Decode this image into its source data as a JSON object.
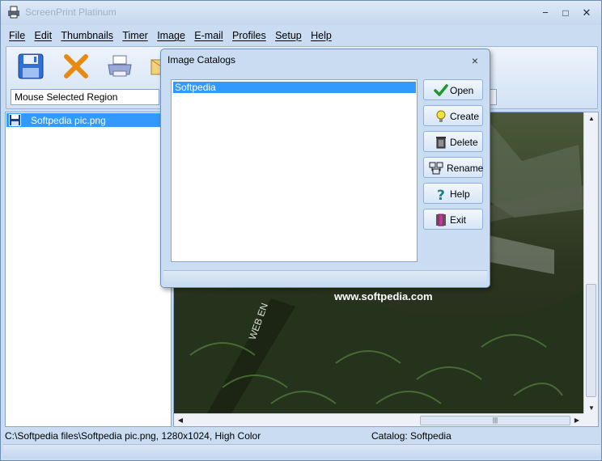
{
  "app": {
    "title": "ScreenPrint Platinum"
  },
  "window_controls": {
    "minimize": "−",
    "maximize": "□",
    "close": "✕"
  },
  "menu": [
    "File",
    "Edit",
    "Thumbnails",
    "Timer",
    "Image",
    "E-mail",
    "Profiles",
    "Setup",
    "Help"
  ],
  "toolbar": {
    "region_value": "Mouse Selected Region"
  },
  "file_list": [
    {
      "name": "Softpedia pic.png"
    }
  ],
  "image_view": {
    "watermark": "www.softpedia.com",
    "vertical_text": "WEB  EN"
  },
  "statusbar": {
    "left": "C:\\Softpedia files\\Softpedia pic.png, 1280x1024, High Color",
    "right": "Catalog: Softpedia"
  },
  "dialog": {
    "title": "Image Catalogs",
    "close": "×",
    "catalogs": [
      "Softpedia"
    ],
    "buttons": {
      "open": "Open",
      "create": "Create",
      "delete": "Delete",
      "rename": "Rename",
      "help": "Help",
      "exit": "Exit"
    }
  },
  "colors": {
    "selection": "#3399ff",
    "chrome": "#c9dcf1"
  }
}
